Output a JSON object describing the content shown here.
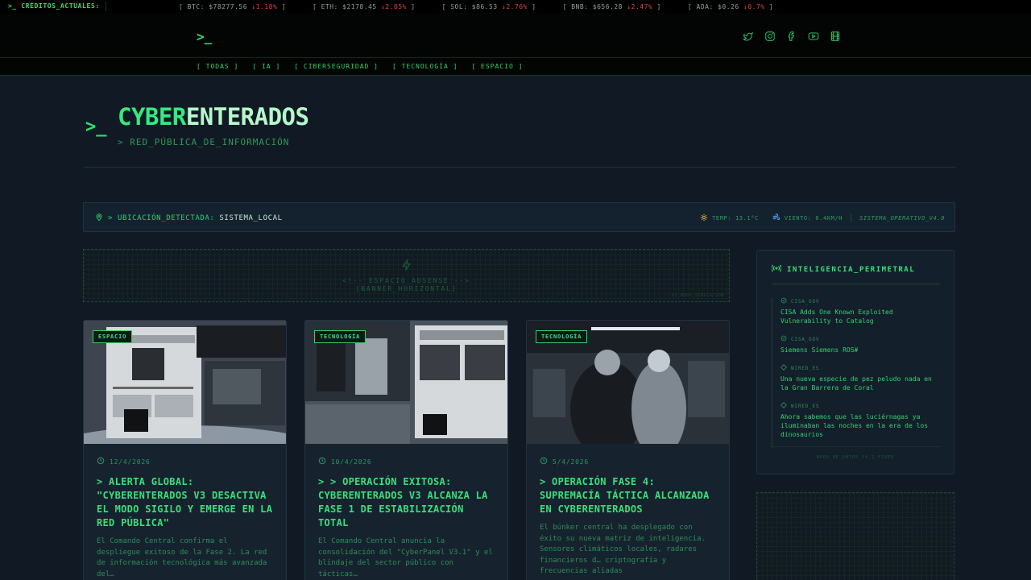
{
  "ticker": {
    "credits_label": ">_ CRÉDITOS_ACTUALES:",
    "coins": [
      {
        "label": "[ BTC: $78277.56",
        "change": "↓1.18%",
        "close": " ]"
      },
      {
        "label": "[ ETH: $2178.45",
        "change": "↓2.05%",
        "close": " ]"
      },
      {
        "label": "[ SOL: $86.53",
        "change": "↓2.76%",
        "close": " ]"
      },
      {
        "label": "[ BNB: $656.28",
        "change": "↓2.47%",
        "close": " ]"
      },
      {
        "label": "[ ADA: $0.26",
        "change": "↓0.7%",
        "close": " ]"
      }
    ]
  },
  "header": {
    "logo": ">_",
    "social": [
      "twitter-icon",
      "instagram-icon",
      "facebook-icon",
      "youtube-icon",
      "film-icon"
    ]
  },
  "nav": [
    "[ TODAS ]",
    "[ IA ]",
    "[ CIBERSEGURIDAD ]",
    "[ TECNOLOGÍA ]",
    "[ ESPACIO ]"
  ],
  "hero": {
    "prompt": ">_",
    "title_a": "CYBER",
    "title_b": "ENTERADOS",
    "subtitle": "> RED_PÚBLICA_DE_INFORMACIÓN"
  },
  "location": {
    "label": "> UBICACIÓN_DETECTADA:",
    "value": "SISTEMA_LOCAL",
    "temp": "TEMP: 13.1°C",
    "wind": "VIENTO: 6.4KM/H",
    "os": "SISTEMA_OPERATIVO_V4.0"
  },
  "adsense": {
    "line1": "<!-- ESPACIO_ADSENSE -->",
    "line2": "[BANNER_HORIZONTAL]",
    "sim": "V3_MODO_SIMULACIÓN"
  },
  "cards": [
    {
      "tag": "ESPACIO",
      "date": "12/4/2026",
      "headline": "> ALERTA GLOBAL: \"CYBERENTERADOS V3 DESACTIVA EL MODO SIGILO Y EMERGE EN LA RED PÚBLICA\"",
      "excerpt": "El Comando Central confirma el despliegue exitoso de la Fase 2. La red de información tecnológica más avanzada del…"
    },
    {
      "tag": "TECNOLOGÍA",
      "date": "10/4/2026",
      "headline": "> > OPERACIÓN EXITOSA: CYBERENTERADOS V3 ALCANZA LA FASE 1 DE ESTABILIZACIÓN TOTAL",
      "excerpt": "El Comando Central anuncia la consolidación del \"CyberPanel V3.1\" y el blindaje del sector público con tácticas…"
    },
    {
      "tag": "TECNOLOGÍA",
      "date": "5/4/2026",
      "headline": "> OPERACIÓN FASE 4: SUPREMACÍA TÁCTICA ALCANZADA EN CYBERENTERADOS",
      "excerpt": "El búnker central ha desplegado con éxito su nueva matriz de inteligencia. Sensores climáticos locales, radares financieros d… criptografía y frecuencias aliadas"
    }
  ],
  "intel": {
    "title": "INTELIGENCIA_PERIMETRAL",
    "items": [
      {
        "source": "CISA_GOV",
        "text": "CISA Adds One Known Exploited Vulnerability to Catalog"
      },
      {
        "source": "CISA_GOV",
        "text": "Siemens Siemens ROS#"
      },
      {
        "source": "WIRED_ES",
        "text": "Una nueva especie de pez peludo nada en la Gran Barrera de Coral"
      },
      {
        "source": "WIRED_ES",
        "text": "Ahora sabemos que las luciérnagas ya iluminaban las noches en la era de los dinosaurios"
      }
    ],
    "footer": "NODO_DE_DATOS_V4.2_FIXED"
  },
  "colors": {
    "accent": "#2fd16a",
    "background": "#111a24",
    "down": "#e0443b"
  }
}
